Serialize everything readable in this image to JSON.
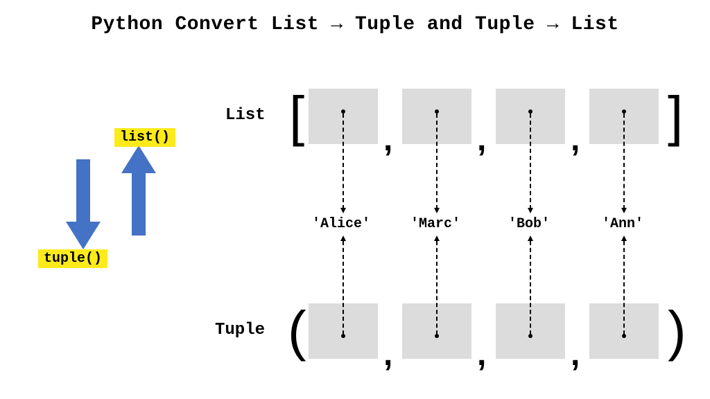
{
  "title": "Python Convert List → Tuple and Tuple → List",
  "labels": {
    "list_fn": "list()",
    "tuple_fn": "tuple()",
    "list_row": "List",
    "tuple_row": "Tuple"
  },
  "items": [
    "'Alice'",
    "'Marc'",
    "'Bob'",
    "'Ann'"
  ],
  "brackets": {
    "open": "[",
    "close": "]"
  },
  "parens": {
    "open": "(",
    "close": ")"
  },
  "comma": ",",
  "colors": {
    "highlight": "#fcea1a",
    "arrow": "#4472c4",
    "slot": "#dcdcdc"
  }
}
